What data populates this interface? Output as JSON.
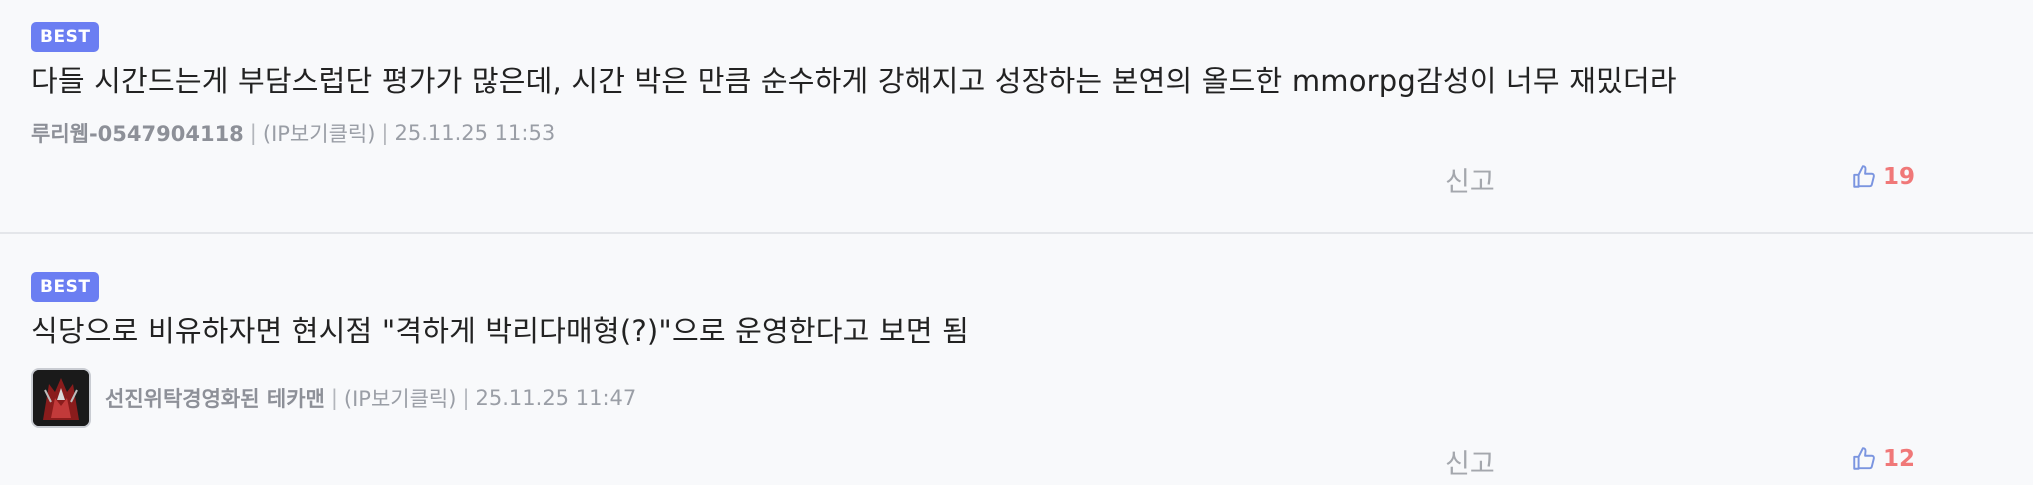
{
  "comments": [
    {
      "badge": "BEST",
      "text": "다들 시간드는게 부담스럽단 평가가 많은데, 시간 박은 만큼 순수하게 강해지고 성장하는 본연의 올드한 mmorpg감성이 너무 재밌더라",
      "author": "루리웹-0547904118",
      "ip": "(IP보기클릭)",
      "datetime": "25.11.25 11:53",
      "report_label": "신고",
      "likes": "19"
    },
    {
      "badge": "BEST",
      "text": "식당으로 비유하자면 현시점 \"격하게 박리다매형(?)\"으로 운영한다고 보면 됨",
      "author": "선진위탁경영화된 테카맨",
      "ip": "(IP보기클릭)",
      "datetime": "25.11.25 11:47",
      "report_label": "신고",
      "likes": "12"
    }
  ],
  "separator": "|",
  "colors": {
    "badge_bg": "#6b7ef2",
    "like_count": "#f07878",
    "like_icon": "#7b95e0",
    "meta": "#9a9ea6"
  },
  "icons": {
    "like": "thumbs-up-icon"
  }
}
